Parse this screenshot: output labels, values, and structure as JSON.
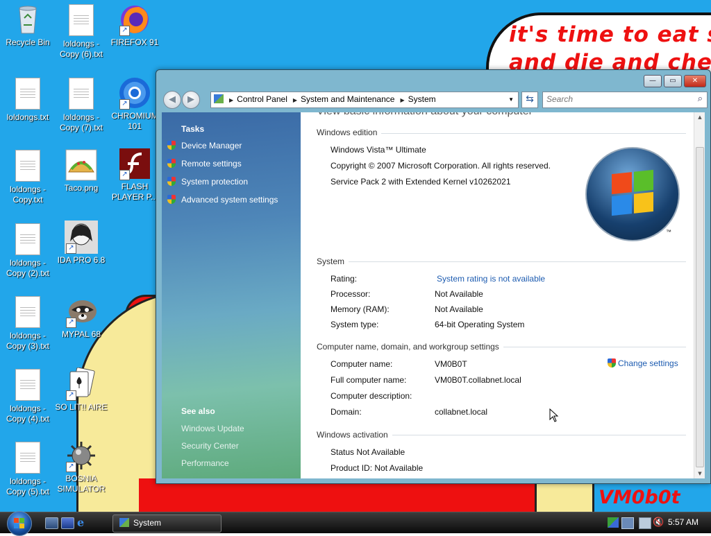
{
  "desktop": {
    "wallpaper": {
      "line1": "it's time to eat shit",
      "line2": "and die and chew",
      "signature": "VM0b0t"
    },
    "icons": [
      {
        "label": "Recycle Bin",
        "icon": "recycle-bin-icon"
      },
      {
        "label": "loldongs - Copy (6).txt",
        "icon": "text-file-icon"
      },
      {
        "label": "FIREFOX 91",
        "icon": "firefox-icon"
      },
      {
        "label": "loldongs.txt",
        "icon": "text-file-icon"
      },
      {
        "label": "loldongs - Copy (7).txt",
        "icon": "text-file-icon"
      },
      {
        "label": "CHROMIUM 101",
        "icon": "chromium-icon"
      },
      {
        "label": "loldongs - Copy.txt",
        "icon": "text-file-icon"
      },
      {
        "label": "Taco.png",
        "icon": "taco-image-icon"
      },
      {
        "label": "FLASH PLAYER P...",
        "icon": "flash-icon"
      },
      {
        "label": "loldongs - Copy (2).txt",
        "icon": "text-file-icon"
      },
      {
        "label": "IDA PRO 6.8",
        "icon": "ida-pro-icon"
      },
      {
        "label": "loldongs - Copy (3).txt",
        "icon": "text-file-icon"
      },
      {
        "label": "MYPAL 68",
        "icon": "raccoon-icon"
      },
      {
        "label": "loldongs - Copy (4).txt",
        "icon": "text-file-icon"
      },
      {
        "label": "SO LIT!! AIRE",
        "icon": "solitaire-icon"
      },
      {
        "label": "loldongs - Copy (5).txt",
        "icon": "text-file-icon"
      },
      {
        "label": "BOSNIA SIMULATOR",
        "icon": "mine-icon"
      }
    ]
  },
  "window": {
    "controls": {
      "minimize": "—",
      "maximize": "▭",
      "close": "✕"
    },
    "breadcrumb": [
      "Control Panel",
      "System and Maintenance",
      "System"
    ],
    "search_placeholder": "Search",
    "left_pane": {
      "tasks_heading": "Tasks",
      "tasks": [
        "Device Manager",
        "Remote settings",
        "System protection",
        "Advanced system settings"
      ],
      "see_also_heading": "See also",
      "see_also": [
        "Windows Update",
        "Security Center",
        "Performance"
      ]
    },
    "main": {
      "clipped_heading": "View basic information about your computer",
      "edition": {
        "heading": "Windows edition",
        "name": "Windows Vista™ Ultimate",
        "copyright": "Copyright © 2007 Microsoft Corporation.  All rights reserved.",
        "service_pack": "Service Pack 2 with Extended Kernel v10262021",
        "logo_tm": "™"
      },
      "system": {
        "heading": "System",
        "rating_label": "Rating:",
        "rating_value": "System rating is not available",
        "processor_label": "Processor:",
        "processor_value": "Not Available",
        "memory_label": "Memory (RAM):",
        "memory_value": "Not Available",
        "type_label": "System type:",
        "type_value": "64-bit Operating System"
      },
      "computer": {
        "heading": "Computer name, domain, and workgroup settings",
        "name_label": "Computer name:",
        "name_value": "VM0B0T",
        "change_settings": "Change settings",
        "full_label": "Full computer name:",
        "full_value": "VM0B0T.collabnet.local",
        "desc_label": "Computer description:",
        "desc_value": "",
        "domain_label": "Domain:",
        "domain_value": "collabnet.local"
      },
      "activation": {
        "heading": "Windows activation",
        "status": "Status Not Available",
        "product_id": "Product ID:  Not Available"
      }
    }
  },
  "taskbar": {
    "active_window": "System",
    "clock": "5:57 AM"
  },
  "colors": {
    "desktop_bg": "#22a6ea",
    "link": "#1c5bb0",
    "wallpaper_text": "#e11111"
  }
}
